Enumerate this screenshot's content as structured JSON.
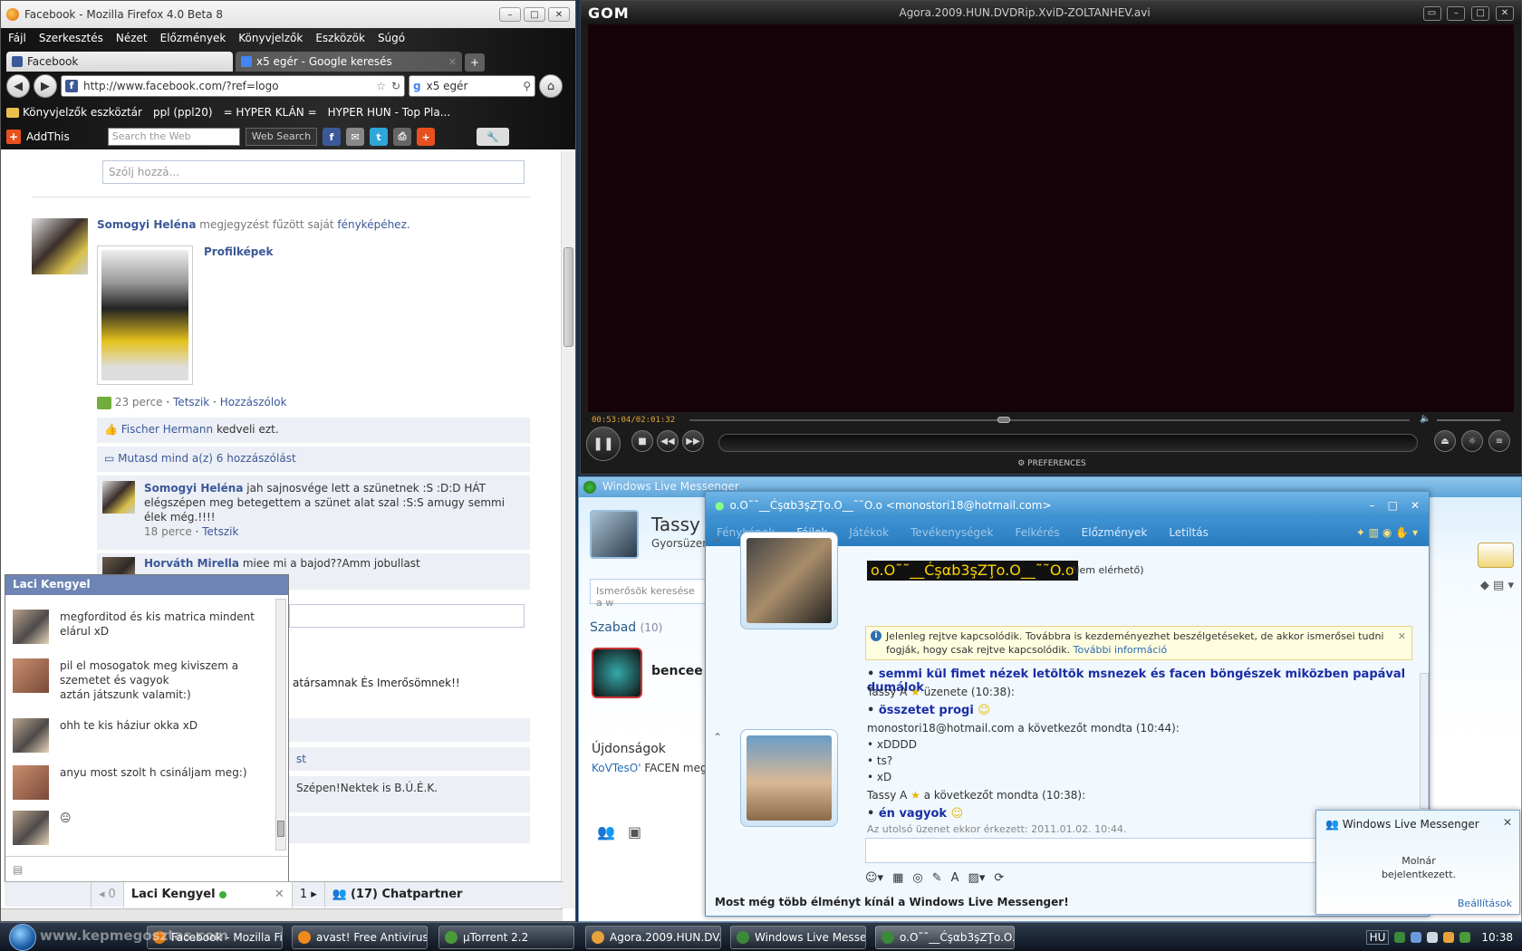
{
  "firefox": {
    "title": "Facebook - Mozilla Firefox 4.0 Beta 8",
    "menu": [
      "Fájl",
      "Szerkesztés",
      "Nézet",
      "Előzmények",
      "Könyvjelzők",
      "Eszközök",
      "Súgó"
    ],
    "tabs": [
      {
        "label": "Facebook"
      },
      {
        "label": "x5 egér - Google keresés"
      }
    ],
    "url": "http://www.facebook.com/?ref=logo",
    "search_value": "x5 egér",
    "bookmarks": [
      "Könyvjelzők eszköztár",
      "ppl (ppl20)",
      "= HYPER KLÁN =",
      "HYPER HUN - Top Pla..."
    ],
    "addthis_label": "AddThis",
    "websearch_placeholder": "Search the Web",
    "websearch_button": "Web Search"
  },
  "feed": {
    "comment_placeholder": "Szólj hozzá...",
    "post": {
      "author": "Somogyi Heléna",
      "action": "megjegyzést fűzött saját",
      "action_link": "fényképéhez.",
      "album": "Profilképek",
      "time": "23 perce",
      "like": "Tetszik",
      "comment": "Hozzászólok",
      "liker": "Fischer Hermann",
      "likes_text": "kedveli ezt.",
      "show_all": "Mutasd mind a(z) 6 hozzászólást",
      "comment1_author": "Somogyi Heléna",
      "comment1_text": "jah sajnosvége lett a szünetnek :S :D:D HÁT elégszépen meg betegettem a szünet alat szal :S:S amugy semmi élek még.!!!!",
      "comment1_time": "18 perce",
      "comment1_like": "Tetszik",
      "comment2_author": "Horváth Mirella",
      "comment2_text": "miee mi a bajod??Amm jobullast"
    },
    "fragments": {
      "greeting": "atársamnak És Imerősömnek!!",
      "st": "st",
      "szepen": "Szépen!Nektek is B.Ú.É.K."
    }
  },
  "fbchat": {
    "name": "Laci Kengyel",
    "messages": [
      {
        "text": "megforditod és kis matrica mindent elárul xD"
      },
      {
        "text": "pil el mosogatok meg kiviszem a szemetet és vagyok"
      },
      {
        "text": "aztán játszunk valamit:)"
      },
      {
        "text": "ohh te kis háziur okka xD"
      },
      {
        "text": "anyu most szolt h csináljam meg:)"
      },
      {
        "text": "😐"
      }
    ],
    "bar_count": "0",
    "bar_tab_name": "Laci Kengyel",
    "bar_one": "1",
    "bar_chatpartner": "(17) Chatpartner"
  },
  "gom": {
    "logo": "GOM",
    "title": "Agora.2009.HUN.DVDRip.XviD-ZOLTANHEV.avi",
    "time": "00:53:04/02:01:32",
    "preferences": "PREFERENCES",
    "progress": 0.436
  },
  "wlm": {
    "title": "Windows Live Messenger",
    "user_name": "Tassy A",
    "status_line": "Gyorsüzene",
    "search_placeholder": "Ismerősök keresése a w",
    "group_label": "Szabad",
    "group_count": "(10)",
    "contact1": "bencee",
    "news_header": "Újdonságok",
    "news_item_author": "KoVTesO'",
    "news_item_text": "FACEN megta"
  },
  "conversation": {
    "title": "o.O˜˜__Ćşαb3şΖŢo.O__˜˜O.o <monostori18@hotmail.com>",
    "menu": [
      "Fényképek",
      "Fájlok",
      "Játékok",
      "Tevékenységek",
      "Felkérés",
      "Előzmények",
      "Letiltás"
    ],
    "nick": "o.O˜˜__Ćşαb3şΖŢo.O__˜˜O.o",
    "status": "(Nem elérhető)",
    "notice_text": "Jelenleg rejtve kapcsolódik. Továbbra is kezdeményezhet beszélgetéseket, de akkor ismerősei tudni fogják, hogy csak rejtve kapcsolódik.",
    "notice_link": "További információ",
    "line1": "semmi kül fimet nézek letöltök msnezek és facen böngészek miközben papával dumálok",
    "line2_name": "Tassy A",
    "line2_rest": "üzenete (10:38):",
    "line3": "összetet progi",
    "line4": "monostori18@hotmail.com a következőt mondta (10:44):",
    "line5": "xDDDD",
    "line6": "ts?",
    "line7": "xD",
    "line8_name": "Tassy A",
    "line8_rest": "a következőt mondta (10:38):",
    "line9": "én vagyok",
    "last_msg": "Az utolsó üzenet ekkor érkezett: 2011.01.02. 10:44.",
    "footer": "Most még több élményt kínál a Windows Live Messenger!"
  },
  "toast": {
    "title": "Windows Live Messenger",
    "body_line1": "Molnár",
    "body_line2": "bejelentkezett.",
    "settings": "Beállítások"
  },
  "taskbar": {
    "watermark": "www.kepmegosztas.com",
    "tasks": [
      "Facebook - Mozilla Fi...",
      "avast! Free Antivirus",
      "µTorrent 2.2",
      "Agora.2009.HUN.DV...",
      "Windows Live Messe...",
      "o.O˜˜__Ćşαb3şΖŢo.O..."
    ],
    "lang": "HU",
    "clock": "10:38"
  },
  "colors": {
    "facebook_blue": "#3b5998",
    "wlm_blue": "#2a7bbd",
    "gom_orange": "#e6a53a"
  }
}
